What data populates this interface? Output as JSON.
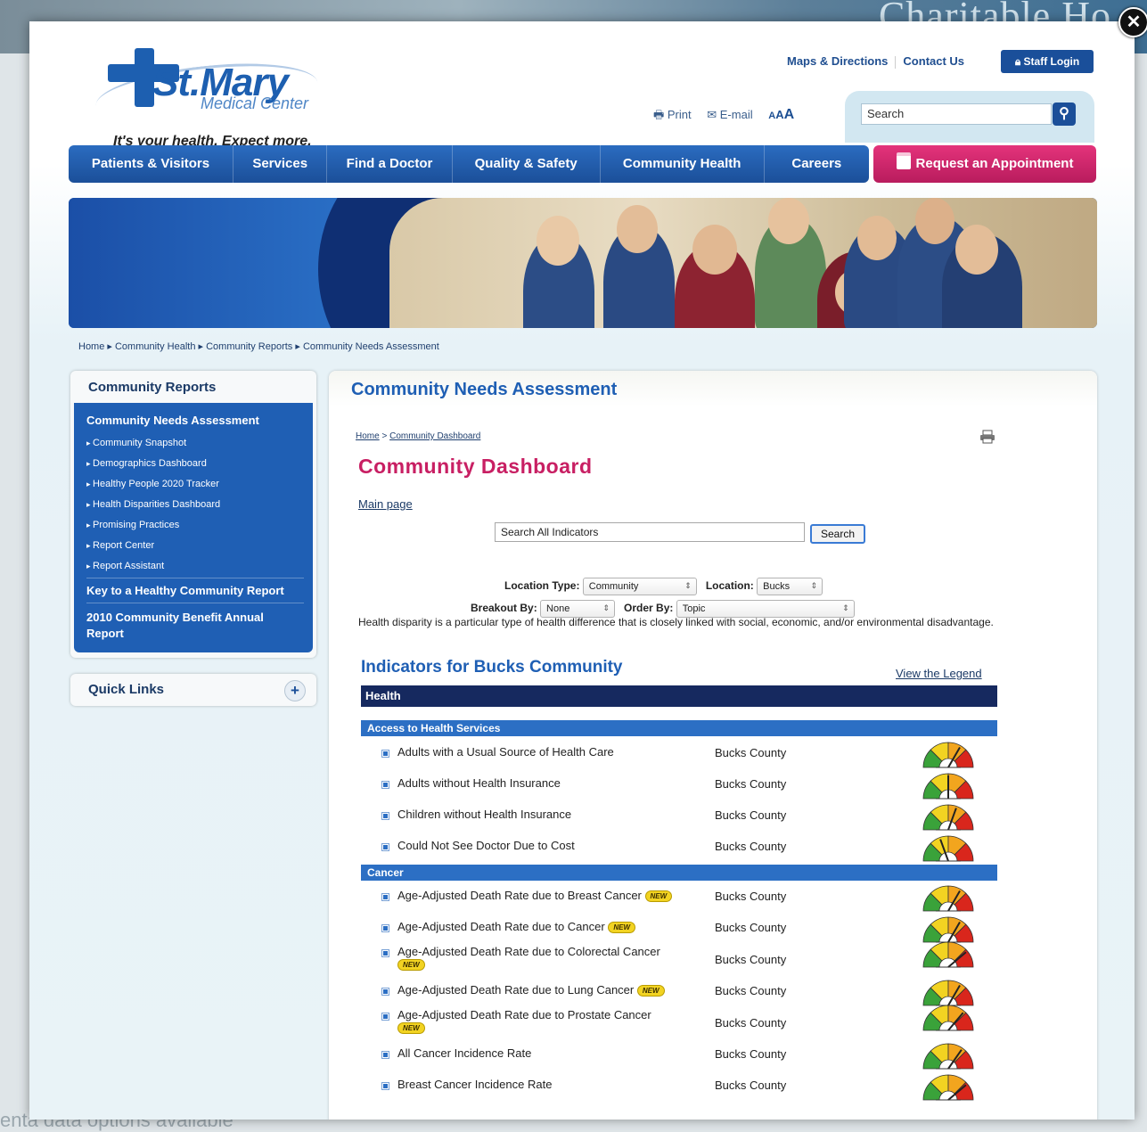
{
  "background": {
    "banner_text": "Charitable Ho",
    "bottom_text": "enta data options available"
  },
  "close_label": "✕",
  "header": {
    "logo_name": "St.Mary",
    "logo_sub": "Medical Center",
    "tagline": "It's your health. Expect more.",
    "top_links": [
      "Maps & Directions",
      "Contact Us"
    ],
    "staff_login": "Staff Login",
    "utility": {
      "print": "Print",
      "email": "E-mail"
    },
    "search_placeholder": "Search"
  },
  "nav": {
    "items": [
      "Patients & Visitors",
      "Services",
      "Find a Doctor",
      "Quality & Safety",
      "Community Health",
      "Careers"
    ],
    "appointment": "Request an Appointment"
  },
  "breadcrumb": [
    "Home",
    "Community Health",
    "Community Reports",
    "Community Needs Assessment"
  ],
  "sidebar": {
    "title": "Community Reports",
    "active": "Community Needs Assessment",
    "sub_items": [
      "Community Snapshot",
      "Demographics Dashboard",
      "Healthy People 2020 Tracker",
      "Health Disparities Dashboard",
      "Promising Practices",
      "Report Center",
      "Report Assistant"
    ],
    "link2": "Key to a Healthy Community Report",
    "link3": "2010 Community Benefit Annual Report",
    "quick_links": "Quick Links"
  },
  "main": {
    "title": "Community Needs Assessment",
    "inner_crumb_home": "Home",
    "inner_crumb_sep": ">",
    "inner_crumb_dash": "Community Dashboard",
    "dashboard_title": "Community Dashboard",
    "main_page": "Main page",
    "search_value": "Search All Indicators",
    "search_btn": "Search",
    "location_type_label": "Location Type:",
    "location_type_value": "Community",
    "location_label": "Location:",
    "location_value": "Bucks",
    "breakout_label": "Breakout By:",
    "breakout_value": "None",
    "order_label": "Order By:",
    "order_value": "Topic",
    "disparity_text": "Health disparity is a particular type of health difference that is closely linked with social, economic, and/or environmental disadvantage.",
    "indicators_title": "Indicators for Bucks Community",
    "legend_link": "View the Legend",
    "health_bar": "Health",
    "cat_access": "Access to Health Services",
    "cat_cancer": "Cancer",
    "new_label": "NEW",
    "access_rows": [
      {
        "label": "Adults with a Usual Source of Health Care",
        "loc": "Bucks County"
      },
      {
        "label": "Adults without Health Insurance",
        "loc": "Bucks County"
      },
      {
        "label": "Children without Health Insurance",
        "loc": "Bucks County"
      },
      {
        "label": "Could Not See Doctor Due to Cost",
        "loc": "Bucks County"
      }
    ],
    "cancer_rows": [
      {
        "label": "Age-Adjusted Death Rate due to Breast Cancer",
        "loc": "Bucks County"
      },
      {
        "label": "Age-Adjusted Death Rate due to Cancer",
        "loc": "Bucks County"
      },
      {
        "label": "Age-Adjusted Death Rate due to Colorectal Cancer",
        "loc": "Bucks County"
      },
      {
        "label": "Age-Adjusted Death Rate due to Lung Cancer",
        "loc": "Bucks County"
      },
      {
        "label": "Age-Adjusted Death Rate due to Prostate Cancer",
        "loc": "Bucks County"
      },
      {
        "label": "All Cancer Incidence Rate",
        "loc": "Bucks County"
      },
      {
        "label": "Breast Cancer Incidence Rate",
        "loc": "Bucks County"
      }
    ]
  }
}
